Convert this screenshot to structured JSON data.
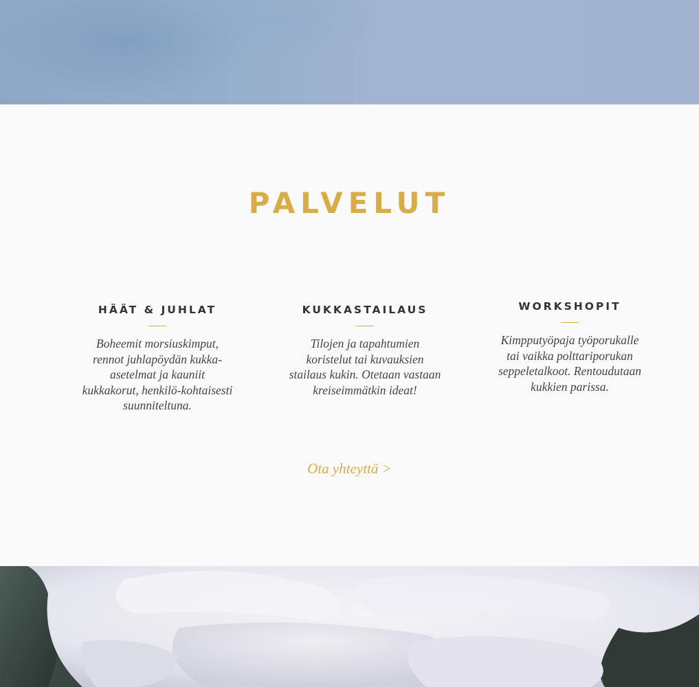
{
  "hero_top": {
    "image": "hazy blue sky background"
  },
  "services": {
    "title": "PALVELUT",
    "items": [
      {
        "heading": "HÄÄT & JUHLAT",
        "text": "Boheemit morsiuskimput, rennot juhlapöydän kukka-asetelmat ja kauniit kukkakorut, henkilö-kohtaisesti suunniteltuna."
      },
      {
        "heading": "KUKKASTAILAUS",
        "text": "Tilojen ja tapahtumien koristelut tai kuvauksien stailaus kukin. Otetaan vastaan kreiseimmätkin ideat!"
      },
      {
        "heading": "WORKSHOPIT",
        "text": "Kimpputyöpaja työporukalle tai vaikka polttariporukan seppeletalkoot. Rentoudutaan kukkien parissa."
      }
    ],
    "contact_link": "Ota yhteyttä >"
  },
  "hero_bottom": {
    "image": "white peony flower close-up"
  },
  "colors": {
    "accent_gold": "#d8ad48",
    "heading_dark": "#333333",
    "background": "#fafafa",
    "hero_blue": "#a1b3d0"
  }
}
